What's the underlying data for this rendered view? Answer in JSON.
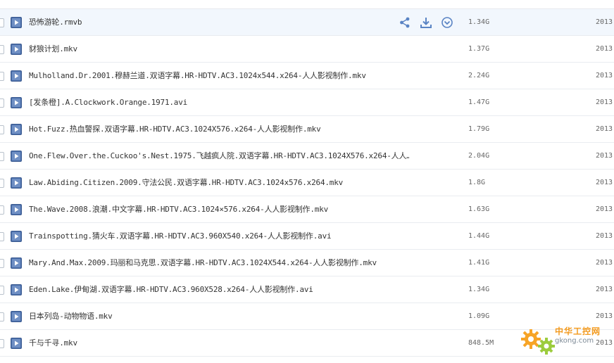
{
  "files": [
    {
      "name": "恐怖游轮.rmvb",
      "size": "1.34G",
      "date": "2013"
    },
    {
      "name": "豺狼计划.mkv",
      "size": "1.37G",
      "date": "2013"
    },
    {
      "name": "Mulholland.Dr.2001.穆赫兰道.双语字幕.HR-HDTV.AC3.1024x544.x264-人人影视制作.mkv",
      "size": "2.24G",
      "date": "2013"
    },
    {
      "name": "[发条橙].A.Clockwork.Orange.1971.avi",
      "size": "1.47G",
      "date": "2013"
    },
    {
      "name": "Hot.Fuzz.热血警探.双语字幕.HR-HDTV.AC3.1024X576.x264-人人影视制作.mkv",
      "size": "1.79G",
      "date": "2013"
    },
    {
      "name": "One.Flew.Over.the.Cuckoo's.Nest.1975.飞越疯人院.双语字幕.HR-HDTV.AC3.1024X576.x264-人人…",
      "size": "2.04G",
      "date": "2013"
    },
    {
      "name": "Law.Abiding.Citizen.2009.守法公民.双语字幕.HR-HDTV.AC3.1024x576.x264.mkv",
      "size": "1.8G",
      "date": "2013"
    },
    {
      "name": "The.Wave.2008.浪潮.中文字幕.HR-HDTV.AC3.1024×576.x264-人人影视制作.mkv",
      "size": "1.63G",
      "date": "2013"
    },
    {
      "name": "Trainspotting.猜火车.双语字幕.HR-HDTV.AC3.960X540.x264-人人影视制作.avi",
      "size": "1.44G",
      "date": "2013"
    },
    {
      "name": "Mary.And.Max.2009.玛丽和马克思.双语字幕.HR-HDTV.AC3.1024X544.x264-人人影视制作.mkv",
      "size": "1.41G",
      "date": "2013"
    },
    {
      "name": "Eden.Lake.伊甸湖.双语字幕.HR-HDTV.AC3.960X528.x264-人人影视制作.avi",
      "size": "1.34G",
      "date": "2013"
    },
    {
      "name": "日本列岛-动物物语.mkv",
      "size": "1.09G",
      "date": "2013"
    },
    {
      "name": "千与千寻.mkv",
      "size": "848.5M",
      "date": "2013"
    }
  ],
  "hovered_row_actions": [
    "share-icon",
    "download-icon",
    "more-dropdown-icon"
  ],
  "file_icon": "video-file-icon",
  "colors": {
    "hover_row": "#f2f7fd",
    "icon_blue": "#4a6ea9",
    "text": "#333333",
    "meta_text": "#666666"
  },
  "watermark": {
    "title": "中华工控网",
    "url": "gkong.com"
  }
}
